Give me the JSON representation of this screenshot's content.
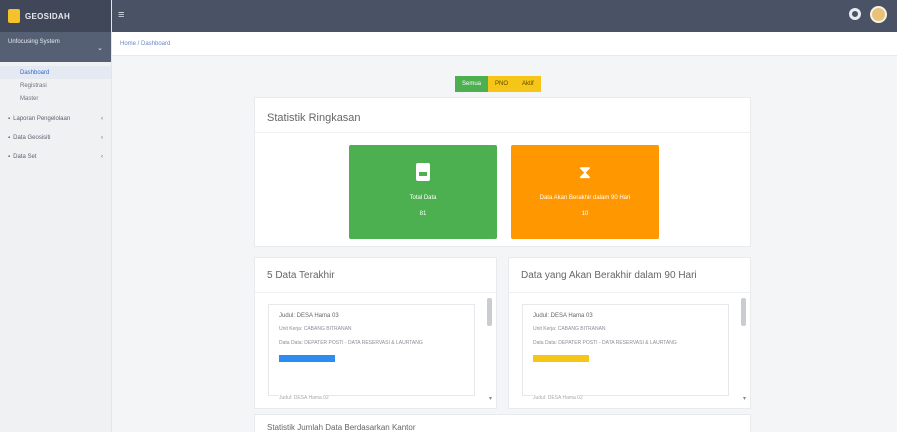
{
  "brand": {
    "name": "GEOSIDAH"
  },
  "topbar": {
    "menu_icon": "hamburger-icon",
    "settings_icon": "gear-icon",
    "avatar_icon": "user-avatar"
  },
  "sidebar": {
    "group": {
      "label": "Unfocusing System",
      "chevron": "⌄"
    },
    "sub_items": [
      {
        "label": "Dashboard",
        "active": true
      },
      {
        "label": "Registrasi",
        "active": false
      },
      {
        "label": "Master",
        "active": false
      }
    ],
    "items": [
      {
        "label": "Laporan Pengelolaan",
        "chevron": "‹"
      },
      {
        "label": "Data Geosisiti",
        "chevron": "‹"
      },
      {
        "label": "Data Set",
        "chevron": "‹"
      }
    ]
  },
  "breadcrumb": {
    "text": "Home / Dashboard"
  },
  "filter_buttons": [
    {
      "label": "Semua",
      "color": "#4caf50"
    },
    {
      "label": "PNO",
      "color": "#f5c518"
    },
    {
      "label": "Aktif",
      "color": "#f5c518"
    }
  ],
  "summary": {
    "title": "Statistik Ringkasan",
    "stats": [
      {
        "label": "Total Data",
        "value": "81",
        "color": "#4caf50",
        "icon": "file-icon"
      },
      {
        "label": "Data Akan Berakhir dalam 90 Hari",
        "value": "10",
        "color": "#ff9800",
        "icon": "hourglass-icon"
      }
    ]
  },
  "latest": {
    "title": "5 Data Terakhir",
    "item": {
      "title": "Judul: DESA Hama 03",
      "line1": "Unit Kerja: CABANG BITRANAN",
      "line2": "Data Data: DEPATER POSTI - DATA RESERVASI & LAURTANG",
      "badge_color": "#2d8cf0"
    },
    "next": "Judul: DESA Hama 02"
  },
  "expiring": {
    "title": "Data yang Akan Berakhir dalam 90 Hari",
    "item": {
      "title": "Judul: DESA Hama 03",
      "line1": "Unit Kerja: CABANG BITRANAN",
      "line2": "Data Data: DEPATER POSTI - DATA RESERVASI & LAURTANG",
      "badge_color": "#f5c518"
    },
    "next": "Judul: DESA Hama 02"
  },
  "bottom": {
    "title": "Statistik Jumlah Data Berdasarkan Kantor"
  }
}
